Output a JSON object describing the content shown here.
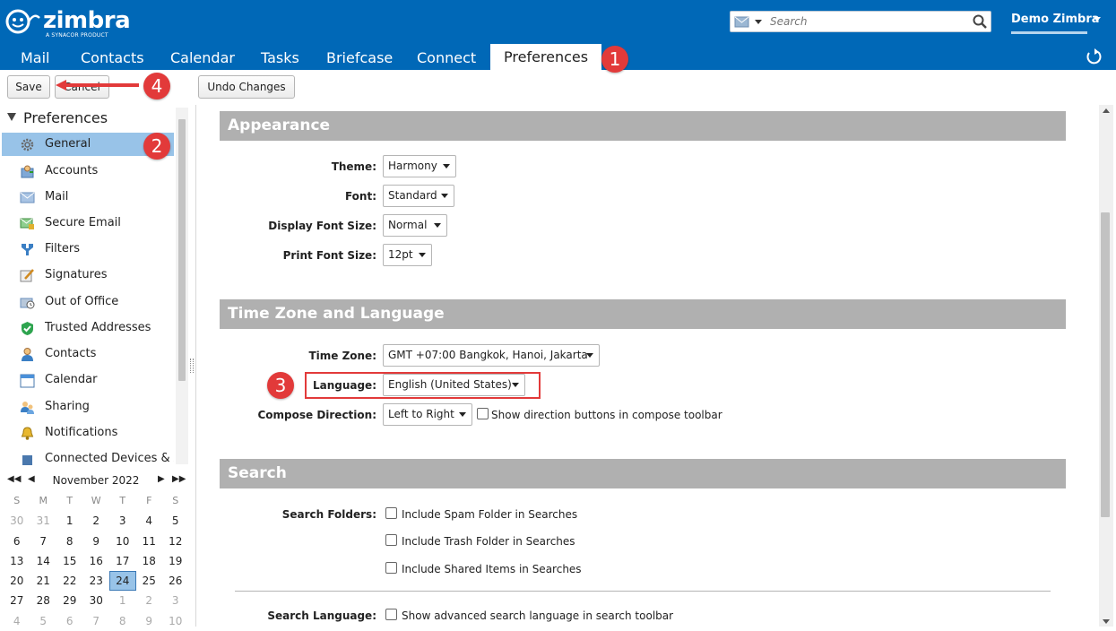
{
  "brand": {
    "name": "zimbra",
    "tagline": "A SYNACOR PRODUCT"
  },
  "search": {
    "placeholder": "Search"
  },
  "user": {
    "name": "Demo Zimbra"
  },
  "app_tabs": [
    {
      "label": "Mail"
    },
    {
      "label": "Contacts"
    },
    {
      "label": "Calendar"
    },
    {
      "label": "Tasks"
    },
    {
      "label": "Briefcase"
    },
    {
      "label": "Connect"
    },
    {
      "label": "Preferences"
    }
  ],
  "toolbar": {
    "save_label": "Save",
    "cancel_label": "Cancel",
    "undo_label": "Undo Changes"
  },
  "callouts": [
    "1",
    "2",
    "3",
    "4"
  ],
  "sidebar": {
    "title": "Preferences",
    "items": [
      {
        "label": "General",
        "icon": "gear-icon"
      },
      {
        "label": "Accounts",
        "icon": "accounts-icon"
      },
      {
        "label": "Mail",
        "icon": "mail-icon"
      },
      {
        "label": "Secure Email",
        "icon": "secure-email-icon"
      },
      {
        "label": "Filters",
        "icon": "filter-icon"
      },
      {
        "label": "Signatures",
        "icon": "signature-icon"
      },
      {
        "label": "Out of Office",
        "icon": "out-of-office-icon"
      },
      {
        "label": "Trusted Addresses",
        "icon": "shield-check-icon"
      },
      {
        "label": "Contacts",
        "icon": "contact-icon"
      },
      {
        "label": "Calendar",
        "icon": "calendar-icon"
      },
      {
        "label": "Sharing",
        "icon": "sharing-icon"
      },
      {
        "label": "Notifications",
        "icon": "bell-icon"
      },
      {
        "label": "Connected Devices & Ap",
        "icon": "device-icon"
      }
    ]
  },
  "mini_calendar": {
    "month": "November 2022",
    "prev_year": "◀◀",
    "prev_month": "◀",
    "next_month": "▶",
    "next_year": "▶▶",
    "days_of_week": [
      "S",
      "M",
      "T",
      "W",
      "T",
      "F",
      "S"
    ],
    "weeks": [
      [
        "30",
        "31",
        "1",
        "2",
        "3",
        "4",
        "5"
      ],
      [
        "6",
        "7",
        "8",
        "9",
        "10",
        "11",
        "12"
      ],
      [
        "13",
        "14",
        "15",
        "16",
        "17",
        "18",
        "19"
      ],
      [
        "20",
        "21",
        "22",
        "23",
        "24",
        "25",
        "26"
      ],
      [
        "27",
        "28",
        "29",
        "30",
        "1",
        "2",
        "3"
      ],
      [
        "4",
        "5",
        "6",
        "7",
        "8",
        "9",
        "10"
      ]
    ],
    "today": "24"
  },
  "sections": {
    "appearance": {
      "title": "Appearance",
      "theme_label": "Theme:",
      "theme_value": "Harmony",
      "font_label": "Font:",
      "font_value": "Standard",
      "display_font_size_label": "Display Font Size:",
      "display_font_size_value": "Normal",
      "print_font_size_label": "Print Font Size:",
      "print_font_size_value": "12pt"
    },
    "timezone": {
      "title": "Time Zone and Language",
      "time_zone_label": "Time Zone:",
      "time_zone_value": "GMT +07:00 Bangkok, Hanoi, Jakarta",
      "language_label": "Language:",
      "language_value": "English (United States)",
      "compose_direction_label": "Compose Direction:",
      "compose_direction_value": "Left to Right",
      "show_direction_label": "Show direction buttons in compose toolbar"
    },
    "search": {
      "title": "Search",
      "search_folders_label": "Search Folders:",
      "include_spam": "Include Spam Folder in Searches",
      "include_trash": "Include Trash Folder in Searches",
      "include_shared": "Include Shared Items in Searches",
      "search_language_label": "Search Language:",
      "show_advanced": "Show advanced search language in search toolbar"
    }
  },
  "colors": {
    "header": "#0068b7",
    "selection": "#98c3e8",
    "section_header": "#b0b0b0",
    "callout": "#e23a3a"
  }
}
